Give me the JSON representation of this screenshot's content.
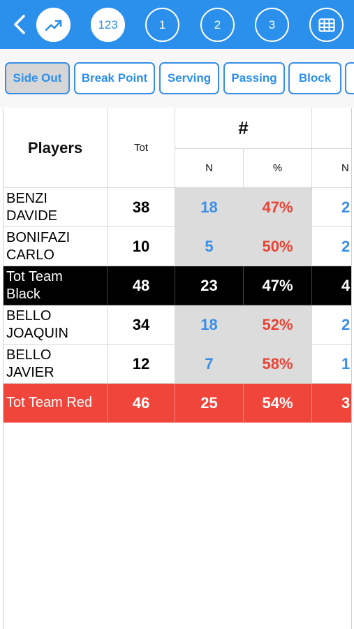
{
  "topbar": {
    "color": "#2b8fec",
    "icons": [
      "back-chevron-icon",
      "trend-chart-icon",
      "grid-table-icon"
    ],
    "buttons": [
      "123",
      "1",
      "2",
      "3"
    ]
  },
  "tabs": [
    {
      "label": "Side Out",
      "active": true
    },
    {
      "label": "Break Point",
      "active": false
    },
    {
      "label": "Serving",
      "active": false
    },
    {
      "label": "Passing",
      "active": false
    },
    {
      "label": "Block",
      "active": false
    },
    {
      "label": "",
      "active": false
    }
  ],
  "table": {
    "headers": {
      "players": "Players",
      "tot": "Tot",
      "group": "#",
      "n": "N",
      "pct": "%",
      "n_next": "N"
    },
    "rows": [
      {
        "name": "BENZI\nDAVIDE",
        "tot": "38",
        "n": "18",
        "pct": "47%",
        "next": "2",
        "style": "player"
      },
      {
        "name": "BONIFAZI\nCARLO",
        "tot": "10",
        "n": "5",
        "pct": "50%",
        "next": "2",
        "style": "player"
      },
      {
        "name": "Tot Team\nBlack",
        "tot": "48",
        "n": "23",
        "pct": "47%",
        "next": "4",
        "style": "black"
      },
      {
        "name": "BELLO\nJOAQUIN",
        "tot": "34",
        "n": "18",
        "pct": "52%",
        "next": "2",
        "style": "player"
      },
      {
        "name": "BELLO\nJAVIER",
        "tot": "12",
        "n": "7",
        "pct": "58%",
        "next": "1",
        "style": "player"
      },
      {
        "name": "Tot Team Red",
        "tot": "46",
        "n": "25",
        "pct": "54%",
        "next": "3",
        "style": "red"
      }
    ]
  }
}
